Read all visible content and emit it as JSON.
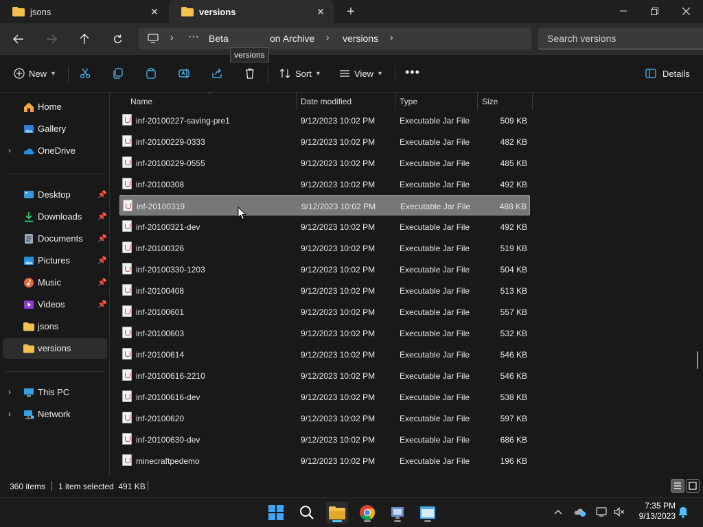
{
  "tabs": [
    {
      "label": "jsons"
    },
    {
      "label": "versions"
    }
  ],
  "breadcrumb": {
    "items": [
      "Beta",
      "on Archive",
      "versions"
    ],
    "tooltip": "versions"
  },
  "search": {
    "placeholder": "Search versions"
  },
  "toolbar": {
    "new_label": "New",
    "sort_label": "Sort",
    "view_label": "View",
    "details_label": "Details"
  },
  "sidebar": {
    "items": [
      {
        "label": "Home"
      },
      {
        "label": "Gallery"
      },
      {
        "label": "OneDrive"
      },
      {
        "label": "Desktop"
      },
      {
        "label": "Downloads"
      },
      {
        "label": "Documents"
      },
      {
        "label": "Pictures"
      },
      {
        "label": "Music"
      },
      {
        "label": "Videos"
      },
      {
        "label": "jsons"
      },
      {
        "label": "versions"
      },
      {
        "label": "This PC"
      },
      {
        "label": "Network"
      }
    ]
  },
  "columns": {
    "name": "Name",
    "date": "Date modified",
    "type": "Type",
    "size": "Size"
  },
  "files": [
    {
      "name": "inf-20100227-saving-pre1",
      "date": "9/12/2023 10:02 PM",
      "type": "Executable Jar File",
      "size": "509 KB"
    },
    {
      "name": "inf-20100229-0333",
      "date": "9/12/2023 10:02 PM",
      "type": "Executable Jar File",
      "size": "482 KB"
    },
    {
      "name": "inf-20100229-0555",
      "date": "9/12/2023 10:02 PM",
      "type": "Executable Jar File",
      "size": "485 KB"
    },
    {
      "name": "inf-20100308",
      "date": "9/12/2023 10:02 PM",
      "type": "Executable Jar File",
      "size": "492 KB"
    },
    {
      "name": "inf-20100319",
      "date": "9/12/2023 10:02 PM",
      "type": "Executable Jar File",
      "size": "488 KB"
    },
    {
      "name": "inf-20100321-dev",
      "date": "9/12/2023 10:02 PM",
      "type": "Executable Jar File",
      "size": "492 KB"
    },
    {
      "name": "inf-20100326",
      "date": "9/12/2023 10:02 PM",
      "type": "Executable Jar File",
      "size": "519 KB"
    },
    {
      "name": "inf-20100330-1203",
      "date": "9/12/2023 10:02 PM",
      "type": "Executable Jar File",
      "size": "504 KB"
    },
    {
      "name": "inf-20100408",
      "date": "9/12/2023 10:02 PM",
      "type": "Executable Jar File",
      "size": "513 KB"
    },
    {
      "name": "inf-20100601",
      "date": "9/12/2023 10:02 PM",
      "type": "Executable Jar File",
      "size": "557 KB"
    },
    {
      "name": "inf-20100603",
      "date": "9/12/2023 10:02 PM",
      "type": "Executable Jar File",
      "size": "532 KB"
    },
    {
      "name": "inf-20100614",
      "date": "9/12/2023 10:02 PM",
      "type": "Executable Jar File",
      "size": "546 KB"
    },
    {
      "name": "inf-20100616-2210",
      "date": "9/12/2023 10:02 PM",
      "type": "Executable Jar File",
      "size": "546 KB"
    },
    {
      "name": "inf-20100616-dev",
      "date": "9/12/2023 10:02 PM",
      "type": "Executable Jar File",
      "size": "538 KB"
    },
    {
      "name": "inf-20100620",
      "date": "9/12/2023 10:02 PM",
      "type": "Executable Jar File",
      "size": "597 KB"
    },
    {
      "name": "inf-20100630-dev",
      "date": "9/12/2023 10:02 PM",
      "type": "Executable Jar File",
      "size": "686 KB"
    },
    {
      "name": "minecraftpedemo",
      "date": "9/12/2023 10:02 PM",
      "type": "Executable Jar File",
      "size": "196 KB"
    }
  ],
  "status": {
    "items_count": "360 items",
    "selection": "1 item selected  491 KB"
  },
  "clock": {
    "time": "7:35 PM",
    "date": "9/13/2023"
  },
  "colors": {
    "folder": "#f2c14e",
    "accent": "#4cc2ff",
    "selection": "#777777"
  }
}
